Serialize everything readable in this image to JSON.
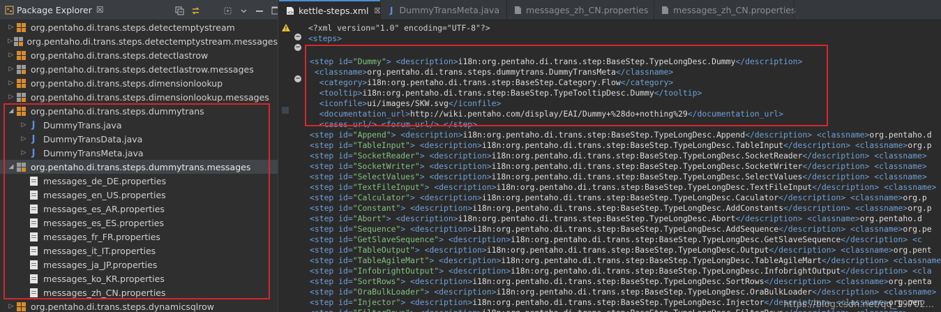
{
  "explorer": {
    "title": "Package Explorer",
    "close": "☒",
    "items": [
      {
        "label": "org.pentaho.di.trans.steps.detectemptystream",
        "kind": "pkg",
        "arrow": "▷",
        "indent": 0
      },
      {
        "label": "org.pentaho.di.trans.steps.detectemptystream.messages",
        "kind": "msg",
        "arrow": "▷",
        "indent": 0
      },
      {
        "label": "org.pentaho.di.trans.steps.detectlastrow",
        "kind": "pkg",
        "arrow": "▷",
        "indent": 0
      },
      {
        "label": "org.pentaho.di.trans.steps.detectlastrow.messages",
        "kind": "msg",
        "arrow": "▷",
        "indent": 0
      },
      {
        "label": "org.pentaho.di.trans.steps.dimensionlookup",
        "kind": "pkg",
        "arrow": "▷",
        "indent": 0
      },
      {
        "label": "org.pentaho.di.trans.steps.dimensionlookup.messages",
        "kind": "msg",
        "arrow": "▷",
        "indent": 0
      },
      {
        "label": "org.pentaho.di.trans.steps.dummytrans",
        "kind": "pkg",
        "arrow": "◢",
        "indent": 0
      },
      {
        "label": "DummyTrans.java",
        "kind": "java",
        "arrow": "▷",
        "indent": 1
      },
      {
        "label": "DummyTransData.java",
        "kind": "java",
        "arrow": "▷",
        "indent": 1
      },
      {
        "label": "DummyTransMeta.java",
        "kind": "java",
        "arrow": "▷",
        "indent": 1
      },
      {
        "label": "org.pentaho.di.trans.steps.dummytrans.messages",
        "kind": "msg",
        "arrow": "◢",
        "indent": 0,
        "selected": true
      },
      {
        "label": "messages_de_DE.properties",
        "kind": "props",
        "arrow": "",
        "indent": 1
      },
      {
        "label": "messages_en_US.properties",
        "kind": "props",
        "arrow": "",
        "indent": 1
      },
      {
        "label": "messages_es_AR.properties",
        "kind": "props",
        "arrow": "",
        "indent": 1
      },
      {
        "label": "messages_es_ES.properties",
        "kind": "props",
        "arrow": "",
        "indent": 1
      },
      {
        "label": "messages_fr_FR.properties",
        "kind": "props",
        "arrow": "",
        "indent": 1
      },
      {
        "label": "messages_it_IT.properties",
        "kind": "props",
        "arrow": "",
        "indent": 1
      },
      {
        "label": "messages_ja_JP.properties",
        "kind": "props",
        "arrow": "",
        "indent": 1
      },
      {
        "label": "messages_ko_KR.properties",
        "kind": "props",
        "arrow": "",
        "indent": 1
      },
      {
        "label": "messages_zh_CN.properties",
        "kind": "props",
        "arrow": "",
        "indent": 1
      },
      {
        "label": "org.pentaho.di.trans.steps.dynamicsqlrow",
        "kind": "pkg",
        "arrow": "▷",
        "indent": 0
      }
    ]
  },
  "tabs": [
    {
      "label": "kettle-steps.xml",
      "active": true,
      "close": "☒"
    },
    {
      "label": "DummyTransMeta.java",
      "active": false
    },
    {
      "label": "messages_zh_CN.properties",
      "active": false
    },
    {
      "label": "messages_zh_CN.properties",
      "active": false
    }
  ],
  "code_lines": [
    [
      [
        "pi",
        "<?xml version=\"1.0\" encoding=\"UTF-8\"?>"
      ]
    ],
    [
      [
        "tag",
        "<steps>"
      ]
    ],
    [],
    [
      [
        "tag",
        "<step "
      ],
      [
        "attr",
        "id="
      ],
      [
        "val",
        "\"Dummy\""
      ],
      [
        "tag",
        "> <description>"
      ],
      [
        "txt",
        "i18n:org.pentaho.di.trans.step:BaseStep.TypeLongDesc.Dummy"
      ],
      [
        "tag",
        "</description>"
      ]
    ],
    [
      [
        "tag",
        " <classname>"
      ],
      [
        "txt",
        "org.pentaho.di.trans.steps.dummytrans.DummyTransMeta"
      ],
      [
        "tag",
        "</classname>"
      ]
    ],
    [
      [
        "tag",
        "  <category>"
      ],
      [
        "txt",
        "i18n:org.pentaho.di.trans.step:BaseStep.Category.Flow"
      ],
      [
        "tag",
        "</category>"
      ]
    ],
    [
      [
        "tag",
        "  <tooltip>"
      ],
      [
        "txt",
        "i18n:org.pentaho.di.trans.step:BaseStep.TypeTooltipDesc.Dummy"
      ],
      [
        "tag",
        "</tooltip>"
      ]
    ],
    [
      [
        "tag",
        "  <iconfile>"
      ],
      [
        "txt",
        "ui/images/SKW.svg"
      ],
      [
        "tag",
        "</iconfile>"
      ]
    ],
    [
      [
        "tag",
        "  <documentation_url>"
      ],
      [
        "txt",
        "http://wiki.pentaho.com/display/EAI/Dummy+%28do+nothing%29"
      ],
      [
        "tag",
        "</documentation_url>"
      ]
    ],
    [
      [
        "tag",
        "  <cases_url/> <forum_url/> </step>"
      ]
    ],
    [
      [
        "tag",
        "<step "
      ],
      [
        "attr",
        "id="
      ],
      [
        "val",
        "\"Append\""
      ],
      [
        "tag",
        "> <description>"
      ],
      [
        "txt",
        "i18n:org.pentaho.di.trans.step:BaseStep.TypeLongDesc.Append"
      ],
      [
        "tag",
        "</description> <classname>"
      ],
      [
        "txt",
        "org.pentaho.d"
      ]
    ],
    [
      [
        "tag",
        "<step "
      ],
      [
        "attr",
        "id="
      ],
      [
        "val",
        "\"TableInput\""
      ],
      [
        "tag",
        "> <description>"
      ],
      [
        "txt",
        "i18n:org.pentaho.di.trans.step:BaseStep.TypeLongDesc.TableInput"
      ],
      [
        "tag",
        "</description> <classname>"
      ],
      [
        "txt",
        "org.p"
      ]
    ],
    [
      [
        "tag",
        "<step "
      ],
      [
        "attr",
        "id="
      ],
      [
        "val",
        "\"SocketReader\""
      ],
      [
        "tag",
        "> <description>"
      ],
      [
        "txt",
        "i18n:org.pentaho.di.trans.step:BaseStep.TypeLongDesc.SocketReader"
      ],
      [
        "tag",
        "</description> <classname>"
      ]
    ],
    [
      [
        "tag",
        "<step "
      ],
      [
        "attr",
        "id="
      ],
      [
        "val",
        "\"SocketWriter\""
      ],
      [
        "tag",
        "> <description>"
      ],
      [
        "txt",
        "i18n:org.pentaho.di.trans.step:BaseStep.TypeLongDesc.SocketWriter"
      ],
      [
        "tag",
        "</description> <classname>"
      ]
    ],
    [
      [
        "tag",
        "<step "
      ],
      [
        "attr",
        "id="
      ],
      [
        "val",
        "\"SelectValues\""
      ],
      [
        "tag",
        "> <description>"
      ],
      [
        "txt",
        "i18n:org.pentaho.di.trans.step:BaseStep.TypeLongDesc.SelectValues"
      ],
      [
        "tag",
        "</description> <classname>"
      ]
    ],
    [
      [
        "tag",
        "<step "
      ],
      [
        "attr",
        "id="
      ],
      [
        "val",
        "\"TextFileInput\""
      ],
      [
        "tag",
        "> <description>"
      ],
      [
        "txt",
        "i18n:org.pentaho.di.trans.step:BaseStep.TypeLongDesc.TextFileInput"
      ],
      [
        "tag",
        "</description> <classname>"
      ]
    ],
    [
      [
        "tag",
        "<step "
      ],
      [
        "attr",
        "id="
      ],
      [
        "val",
        "\"Calculator\""
      ],
      [
        "tag",
        "> <description>"
      ],
      [
        "txt",
        "i18n:org.pentaho.di.trans.step:BaseStep.TypeLongDesc.Caculator"
      ],
      [
        "tag",
        "</description> <classname>"
      ],
      [
        "txt",
        "org.p"
      ]
    ],
    [
      [
        "tag",
        "<step "
      ],
      [
        "attr",
        "id="
      ],
      [
        "val",
        "\"Constant\""
      ],
      [
        "tag",
        "> <description>"
      ],
      [
        "txt",
        "i18n:org.pentaho.di.trans.step:BaseStep.TypeLongDesc.AddConstants"
      ],
      [
        "tag",
        "</description> <classname>"
      ],
      [
        "txt",
        "org.p"
      ]
    ],
    [
      [
        "tag",
        "<step "
      ],
      [
        "attr",
        "id="
      ],
      [
        "val",
        "\"Abort\""
      ],
      [
        "tag",
        "> <description>"
      ],
      [
        "txt",
        "i18n:org.pentaho.di.trans.step:BaseStep.TypeLongDesc.Abort"
      ],
      [
        "tag",
        "</description> <classname>"
      ],
      [
        "txt",
        "org.pentaho.d"
      ]
    ],
    [
      [
        "tag",
        "<step "
      ],
      [
        "attr",
        "id="
      ],
      [
        "val",
        "\"Sequence\""
      ],
      [
        "tag",
        "> <description>"
      ],
      [
        "txt",
        "i18n:org.pentaho.di.trans.step:BaseStep.TypeLongDesc.AddSequence"
      ],
      [
        "tag",
        "</description> <classname>"
      ],
      [
        "txt",
        "org.pe"
      ]
    ],
    [
      [
        "tag",
        "<step "
      ],
      [
        "attr",
        "id="
      ],
      [
        "val",
        "\"GetSlaveSequence\""
      ],
      [
        "tag",
        "> <description>"
      ],
      [
        "txt",
        "i18n:org.pentaho.di.trans.step:BaseStep.TypeLongDesc.GetSlaveSequence"
      ],
      [
        "tag",
        "</description> <c"
      ]
    ],
    [
      [
        "tag",
        "<step "
      ],
      [
        "attr",
        "id="
      ],
      [
        "val",
        "\"TableOutput\""
      ],
      [
        "tag",
        "> <description>"
      ],
      [
        "txt",
        "i18n:org.pentaho.di.trans.step:BaseStep.TypeLongDesc.Output"
      ],
      [
        "tag",
        "</description> <classname>"
      ],
      [
        "txt",
        "org.pent"
      ]
    ],
    [
      [
        "tag",
        "<step "
      ],
      [
        "attr",
        "id="
      ],
      [
        "val",
        "\"TableAgileMart\""
      ],
      [
        "tag",
        "> <description>"
      ],
      [
        "txt",
        "i18n:org.pentaho.di.trans.step:BaseStep.TypeLongDesc.TableAgileMart"
      ],
      [
        "tag",
        "</description> <classname>"
      ]
    ],
    [
      [
        "tag",
        "<step "
      ],
      [
        "attr",
        "id="
      ],
      [
        "val",
        "\"InfobrightOutput\""
      ],
      [
        "tag",
        "> <description>"
      ],
      [
        "txt",
        "i18n:org.pentaho.di.trans.step:BaseStep.TypeLongDesc.InfobrightOutput"
      ],
      [
        "tag",
        "</description> <cla"
      ]
    ],
    [
      [
        "tag",
        "<step "
      ],
      [
        "attr",
        "id="
      ],
      [
        "val",
        "\"SortRows\""
      ],
      [
        "tag",
        "> <description>"
      ],
      [
        "txt",
        "i18n:org.pentaho.di.trans.step:BaseStep.TypeLongDesc.SortRows"
      ],
      [
        "tag",
        "</description> <classname>"
      ],
      [
        "txt",
        "org.penta"
      ]
    ],
    [
      [
        "tag",
        "<step "
      ],
      [
        "attr",
        "id="
      ],
      [
        "val",
        "\"OraBulkLoader\""
      ],
      [
        "tag",
        "> <description>"
      ],
      [
        "txt",
        "i18n:org.pentaho.di.trans.step:BaseStep.TypeLongDesc.OraBulkLoader"
      ],
      [
        "tag",
        "</description> <classname>"
      ]
    ],
    [
      [
        "tag",
        "<step "
      ],
      [
        "attr",
        "id="
      ],
      [
        "val",
        "\"Injector\""
      ],
      [
        "tag",
        "> <description>"
      ],
      [
        "txt",
        "i18n:org.pentaho.di.trans.step:BaseStep.TypeLongDesc.Injector"
      ],
      [
        "tag",
        "</description> <classname>"
      ],
      [
        "txt",
        "org.pen"
      ]
    ],
    [
      [
        "tag",
        "<step "
      ],
      [
        "attr",
        "id="
      ],
      [
        "val",
        "\"FilterRows\""
      ],
      [
        "tag",
        "> <description>"
      ],
      [
        "txt",
        "i18n:org.pentaho.di.trans.step:BaseStep.TypeLongDesc.FilterRows"
      ],
      [
        "tag",
        "</description> <classname>"
      ]
    ]
  ],
  "watermark": "https://blog.csdn.net/qq_19702...",
  "colors": {
    "highlight_box": "#d8262c",
    "accent_tab": "#4b8fd6"
  }
}
